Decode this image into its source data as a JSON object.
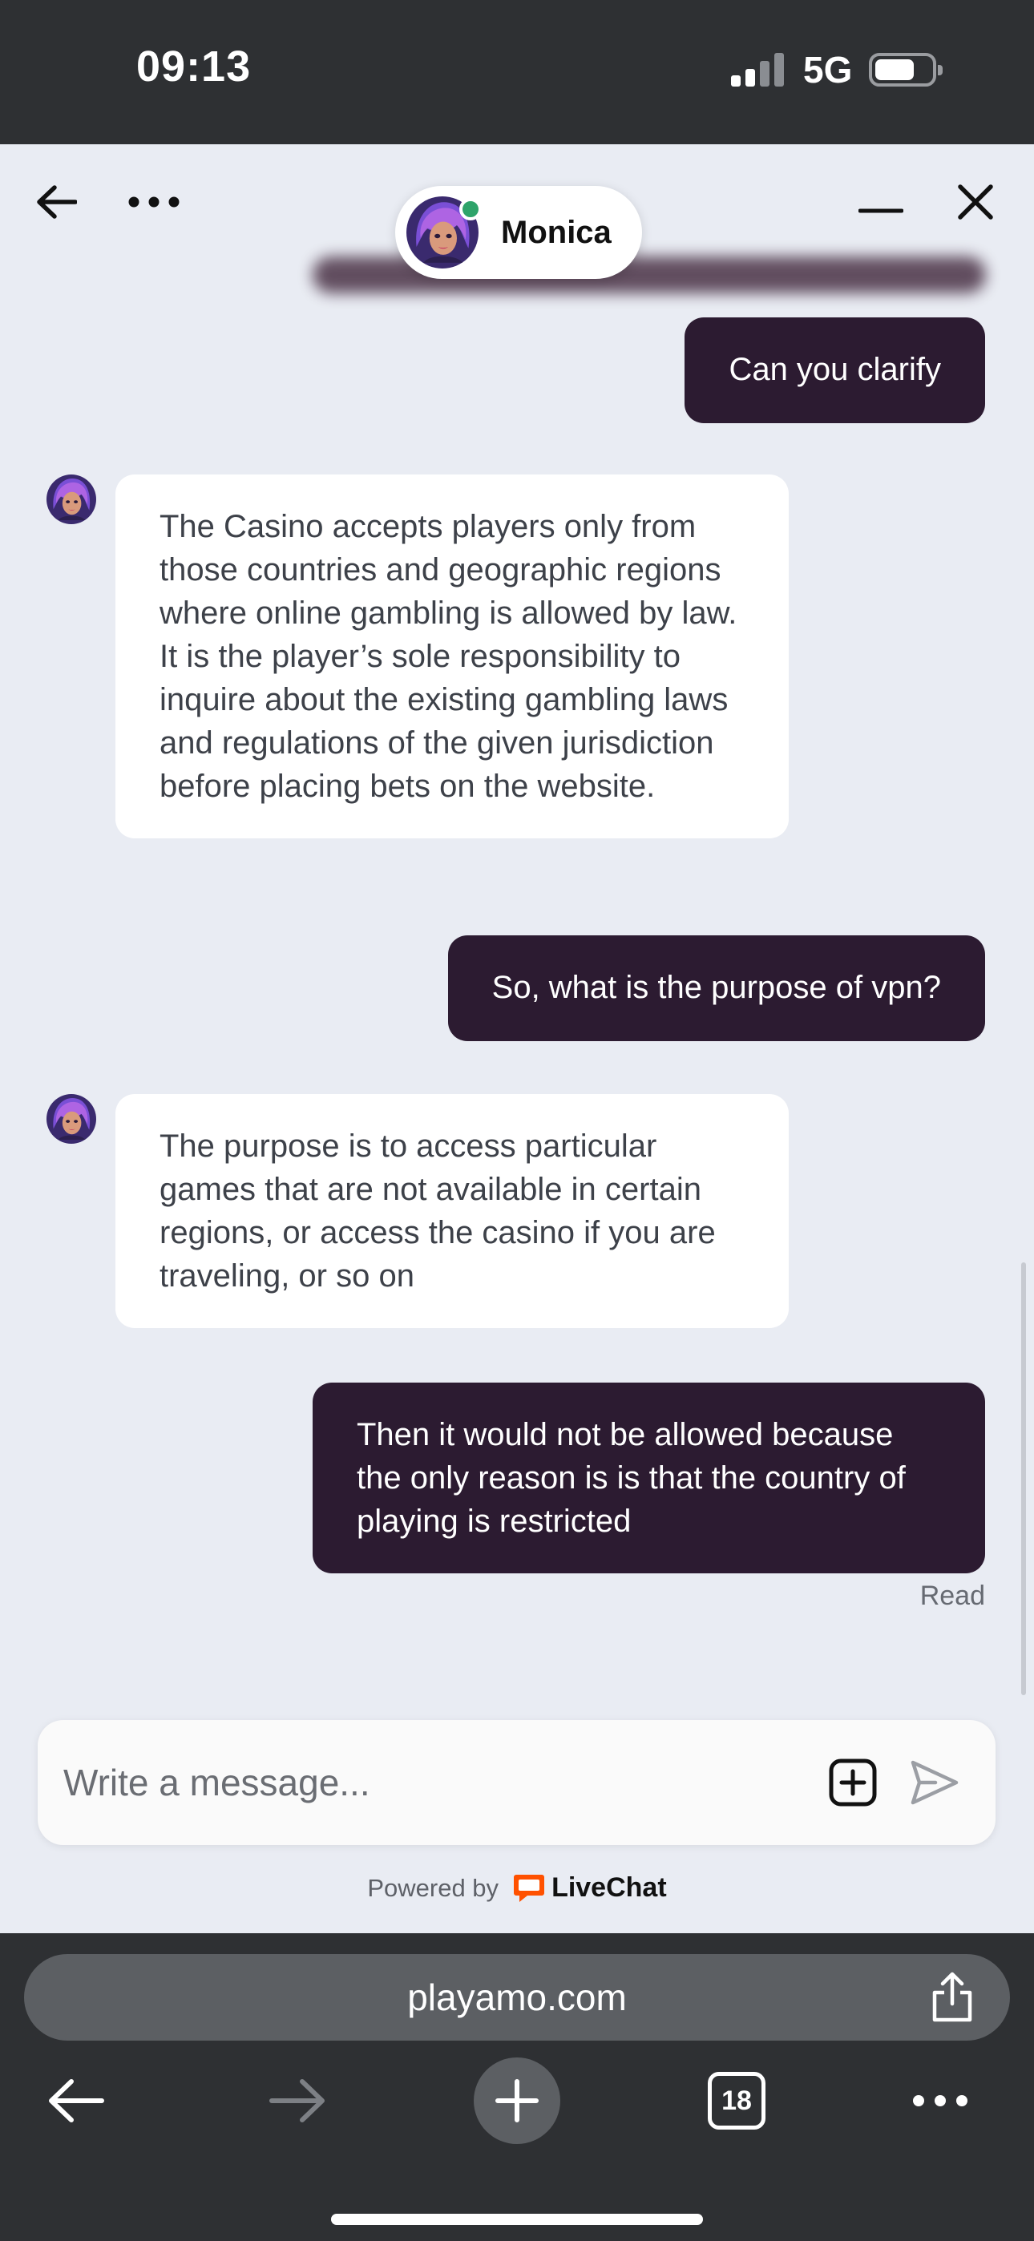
{
  "status_bar": {
    "time": "09:13",
    "network": "5G",
    "battery_level": 0.7
  },
  "chat_header": {
    "agent_name": "Monica",
    "agent_online": true,
    "icons": {
      "back": "arrow-left-icon",
      "more": "more-horizontal-icon",
      "minimize": "minimize-icon",
      "close": "close-icon"
    }
  },
  "messages": [
    {
      "from": "user",
      "text": "Can you clarify"
    },
    {
      "from": "agent",
      "text": "The Casino accepts players only from those countries and geographic regions where online gambling is allowed by law. It is the player’s sole responsibility to inquire about the existing gambling laws and regulations of the given jurisdiction before placing bets on the website."
    },
    {
      "from": "user",
      "text": "So, what is the purpose of vpn?"
    },
    {
      "from": "agent",
      "text": "The purpose is to access particular games that are not available in certain regions, or access the casino if you are traveling, or so on"
    },
    {
      "from": "user",
      "text": "Then it would not be allowed because the only reason is is that the country of playing is restricted"
    }
  ],
  "read_receipt": "Read",
  "composer": {
    "placeholder": "Write a message...",
    "value": ""
  },
  "footer": {
    "powered_by": "Powered by",
    "brand": "LiveChat",
    "brand_color": "#ff5100"
  },
  "browser": {
    "url": "playamo.com",
    "tab_count": "18"
  },
  "colors": {
    "user_bubble": "#2c1b31",
    "agent_bubble": "#ffffff",
    "chat_background": "#e9ecf3",
    "online": "#2ea36a"
  }
}
